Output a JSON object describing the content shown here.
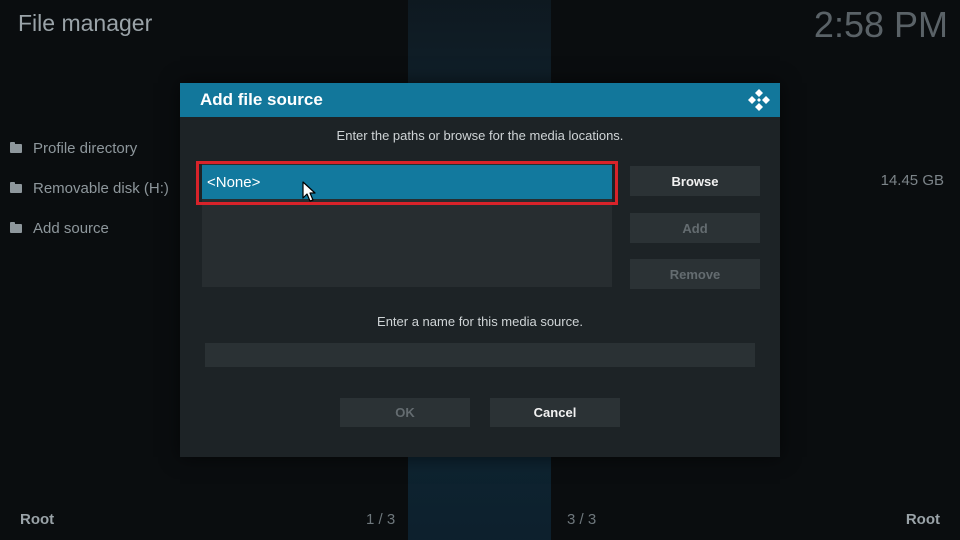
{
  "app": {
    "title": "File manager",
    "clock": "2:58 PM"
  },
  "sidebar": {
    "items": [
      {
        "label": "Profile directory",
        "icon": "folder-icon"
      },
      {
        "label": "Removable disk (H:)",
        "icon": "folder-icon"
      },
      {
        "label": "Add source",
        "icon": "folder-icon"
      }
    ],
    "disk_size": "14.45 GB"
  },
  "footer": {
    "left": "Root",
    "page_left": "1 / 3",
    "page_right": "3 / 3",
    "right": "Root"
  },
  "dialog": {
    "title": "Add file source",
    "logo_icon": "kodi-logo-icon",
    "path_instruction": "Enter the paths or browse for the media locations.",
    "paths": [
      "<None>"
    ],
    "buttons": {
      "browse": "Browse",
      "add": "Add",
      "remove": "Remove"
    },
    "name_instruction": "Enter a name for this media source.",
    "name_value": "",
    "ok": "OK",
    "cancel": "Cancel"
  },
  "colors": {
    "header": "#12779b",
    "selected_item": "#12799e",
    "highlight_border": "#d8232a"
  }
}
